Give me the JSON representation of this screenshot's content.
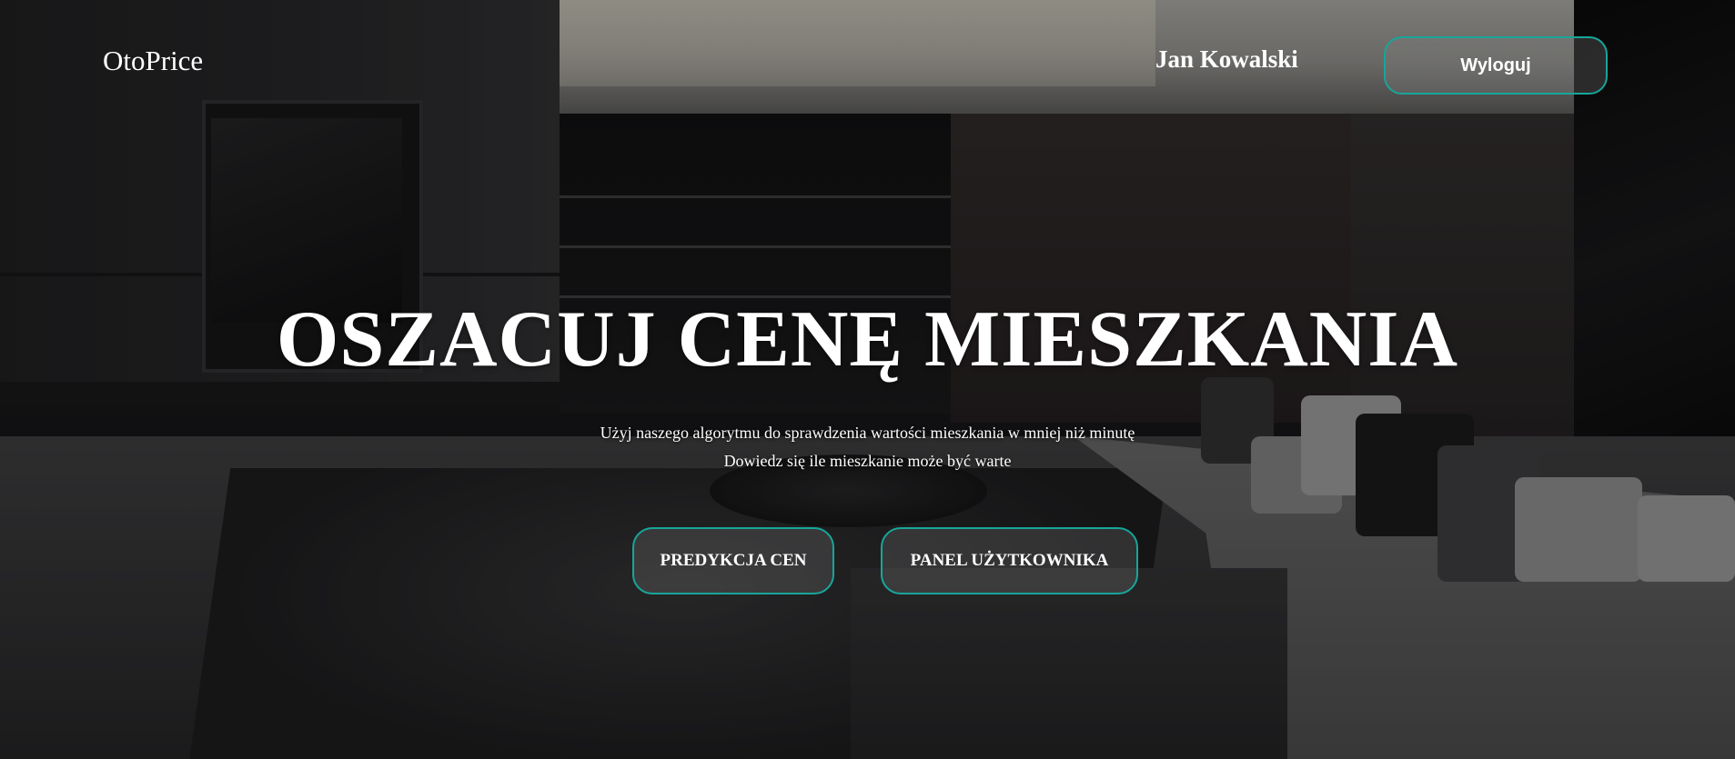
{
  "navbar": {
    "brand": "OtoPrice",
    "user_name": "Jan Kowalski",
    "logout_label": "Wyloguj"
  },
  "hero": {
    "title": "OSZACUJ CENĘ MIESZKANIA",
    "subtitle_1": "Użyj naszego algorytmu do sprawdzenia wartości mieszkania w mniej niż minutę",
    "subtitle_2": "Dowiedz się ile mieszkanie może być warte",
    "buttons": [
      {
        "label": "PREDYKCJA CEN"
      },
      {
        "label": "PANEL UŻYTKOWNIKA"
      }
    ]
  },
  "colors": {
    "accent_border": "#17a69a",
    "text": "#ffffff"
  }
}
